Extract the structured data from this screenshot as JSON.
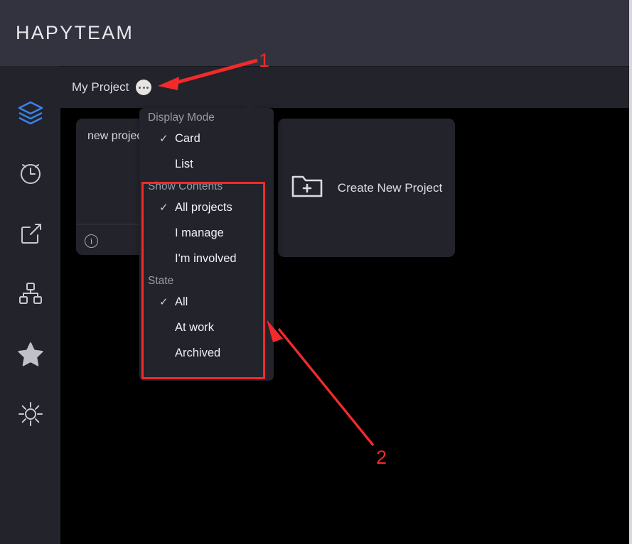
{
  "header": {
    "brand_title": "HAPYTEAM"
  },
  "sidebar": {
    "items": [
      {
        "icon": "layers-icon",
        "name": "sidebar-item-projects",
        "active": true
      },
      {
        "icon": "alarm-clock-icon",
        "name": "sidebar-item-schedule",
        "active": false
      },
      {
        "icon": "share-export-icon",
        "name": "sidebar-item-share",
        "active": false
      },
      {
        "icon": "sitemap-icon",
        "name": "sidebar-item-organization",
        "active": false
      },
      {
        "icon": "star-icon",
        "name": "sidebar-item-favorites",
        "active": false
      },
      {
        "icon": "gear-icon",
        "name": "sidebar-item-settings",
        "active": false
      }
    ],
    "active_color": "#3b82e8",
    "inactive_color": "#c8c9d0"
  },
  "project_bar": {
    "title": "My Project",
    "more_button_icon": "ellipsis-icon"
  },
  "cards": {
    "project": {
      "title": "new projec",
      "info_icon": "info-circle-icon"
    },
    "create": {
      "label": "Create New Project",
      "icon": "folder-plus-icon"
    }
  },
  "menu": {
    "sections": [
      {
        "label": "Display Mode",
        "items": [
          {
            "label": "Card",
            "checked": true
          },
          {
            "label": "List",
            "checked": false
          }
        ]
      },
      {
        "label": "Show Contents",
        "items": [
          {
            "label": "All projects",
            "checked": true
          },
          {
            "label": "I manage",
            "checked": false
          },
          {
            "label": "I'm involved",
            "checked": false
          }
        ]
      },
      {
        "label": "State",
        "items": [
          {
            "label": "All",
            "checked": true
          },
          {
            "label": "At work",
            "checked": false
          },
          {
            "label": "Archived",
            "checked": false
          }
        ]
      }
    ],
    "check_glyph": "✓"
  },
  "annotations": {
    "color": "#f22a2a",
    "marker_one": "1",
    "marker_two": "2"
  }
}
